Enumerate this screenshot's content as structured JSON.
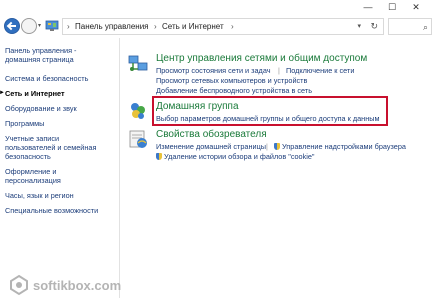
{
  "window": {
    "minimize_glyph": "—",
    "maximize_glyph": "☐",
    "close_glyph": "✕"
  },
  "address": {
    "separator": "›",
    "crumbs": [
      "Панель управления",
      "Сеть и Интернет"
    ],
    "dropdown_glyph": "▾",
    "refresh_glyph": "↻",
    "search_glyph": "⌕",
    "nav_dropdown_glyph": "▾"
  },
  "sidebar": {
    "items": [
      {
        "label": "Панель управления -"
      },
      {
        "label": "домашняя страница"
      },
      {
        "label": "Система и безопасность"
      },
      {
        "label": "Сеть и Интернет"
      },
      {
        "label": "Оборудование и звук"
      },
      {
        "label": "Программы"
      },
      {
        "label": "Учетные записи"
      },
      {
        "label": "пользователей и семейная"
      },
      {
        "label": "безопасность"
      },
      {
        "label": "Оформление и"
      },
      {
        "label": "персонализация"
      },
      {
        "label": "Часы, язык и регион"
      },
      {
        "label": "Специальные возможности"
      }
    ],
    "current_arrow": "►"
  },
  "sections": [
    {
      "title": "Центр управления сетями и общим доступом",
      "links": [
        "Просмотр состояния сети и задач",
        "Подключение к сети",
        "Просмотр сетевых компьютеров и устройств",
        "Добавление беспроводного устройства в сеть"
      ]
    },
    {
      "title": "Домашняя группа",
      "links": [
        "Выбор параметров домашней группы и общего доступа к данным"
      ]
    },
    {
      "title": "Свойства обозревателя",
      "links": [
        "Изменение домашней страницы",
        "Управление надстройками браузера",
        "Удаление истории обзора и файлов \"cookie\""
      ]
    }
  ],
  "link_separator": "|",
  "watermark": {
    "text": "softikbox.com"
  },
  "colors": {
    "section_title": "#1a7a3a",
    "link": "#1c3d7a",
    "highlight": "#c8102e"
  }
}
